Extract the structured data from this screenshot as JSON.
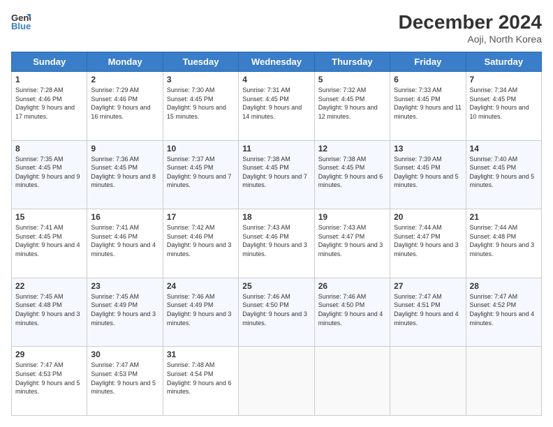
{
  "header": {
    "logo_line1": "General",
    "logo_line2": "Blue",
    "month_title": "December 2024",
    "location": "Aoji, North Korea"
  },
  "weekdays": [
    "Sunday",
    "Monday",
    "Tuesday",
    "Wednesday",
    "Thursday",
    "Friday",
    "Saturday"
  ],
  "weeks": [
    [
      {
        "day": "1",
        "sunrise": "7:28 AM",
        "sunset": "4:46 PM",
        "daylight": "9 hours and 17 minutes"
      },
      {
        "day": "2",
        "sunrise": "7:29 AM",
        "sunset": "4:46 PM",
        "daylight": "9 hours and 16 minutes"
      },
      {
        "day": "3",
        "sunrise": "7:30 AM",
        "sunset": "4:45 PM",
        "daylight": "9 hours and 15 minutes"
      },
      {
        "day": "4",
        "sunrise": "7:31 AM",
        "sunset": "4:45 PM",
        "daylight": "9 hours and 14 minutes"
      },
      {
        "day": "5",
        "sunrise": "7:32 AM",
        "sunset": "4:45 PM",
        "daylight": "9 hours and 12 minutes"
      },
      {
        "day": "6",
        "sunrise": "7:33 AM",
        "sunset": "4:45 PM",
        "daylight": "9 hours and 11 minutes"
      },
      {
        "day": "7",
        "sunrise": "7:34 AM",
        "sunset": "4:45 PM",
        "daylight": "9 hours and 10 minutes"
      }
    ],
    [
      {
        "day": "8",
        "sunrise": "7:35 AM",
        "sunset": "4:45 PM",
        "daylight": "9 hours and 9 minutes"
      },
      {
        "day": "9",
        "sunrise": "7:36 AM",
        "sunset": "4:45 PM",
        "daylight": "9 hours and 8 minutes"
      },
      {
        "day": "10",
        "sunrise": "7:37 AM",
        "sunset": "4:45 PM",
        "daylight": "9 hours and 7 minutes"
      },
      {
        "day": "11",
        "sunrise": "7:38 AM",
        "sunset": "4:45 PM",
        "daylight": "9 hours and 7 minutes"
      },
      {
        "day": "12",
        "sunrise": "7:38 AM",
        "sunset": "4:45 PM",
        "daylight": "9 hours and 6 minutes"
      },
      {
        "day": "13",
        "sunrise": "7:39 AM",
        "sunset": "4:45 PM",
        "daylight": "9 hours and 5 minutes"
      },
      {
        "day": "14",
        "sunrise": "7:40 AM",
        "sunset": "4:45 PM",
        "daylight": "9 hours and 5 minutes"
      }
    ],
    [
      {
        "day": "15",
        "sunrise": "7:41 AM",
        "sunset": "4:45 PM",
        "daylight": "9 hours and 4 minutes"
      },
      {
        "day": "16",
        "sunrise": "7:41 AM",
        "sunset": "4:46 PM",
        "daylight": "9 hours and 4 minutes"
      },
      {
        "day": "17",
        "sunrise": "7:42 AM",
        "sunset": "4:46 PM",
        "daylight": "9 hours and 3 minutes"
      },
      {
        "day": "18",
        "sunrise": "7:43 AM",
        "sunset": "4:46 PM",
        "daylight": "9 hours and 3 minutes"
      },
      {
        "day": "19",
        "sunrise": "7:43 AM",
        "sunset": "4:47 PM",
        "daylight": "9 hours and 3 minutes"
      },
      {
        "day": "20",
        "sunrise": "7:44 AM",
        "sunset": "4:47 PM",
        "daylight": "9 hours and 3 minutes"
      },
      {
        "day": "21",
        "sunrise": "7:44 AM",
        "sunset": "4:48 PM",
        "daylight": "9 hours and 3 minutes"
      }
    ],
    [
      {
        "day": "22",
        "sunrise": "7:45 AM",
        "sunset": "4:48 PM",
        "daylight": "9 hours and 3 minutes"
      },
      {
        "day": "23",
        "sunrise": "7:45 AM",
        "sunset": "4:49 PM",
        "daylight": "9 hours and 3 minutes"
      },
      {
        "day": "24",
        "sunrise": "7:46 AM",
        "sunset": "4:49 PM",
        "daylight": "9 hours and 3 minutes"
      },
      {
        "day": "25",
        "sunrise": "7:46 AM",
        "sunset": "4:50 PM",
        "daylight": "9 hours and 3 minutes"
      },
      {
        "day": "26",
        "sunrise": "7:46 AM",
        "sunset": "4:50 PM",
        "daylight": "9 hours and 4 minutes"
      },
      {
        "day": "27",
        "sunrise": "7:47 AM",
        "sunset": "4:51 PM",
        "daylight": "9 hours and 4 minutes"
      },
      {
        "day": "28",
        "sunrise": "7:47 AM",
        "sunset": "4:52 PM",
        "daylight": "9 hours and 4 minutes"
      }
    ],
    [
      {
        "day": "29",
        "sunrise": "7:47 AM",
        "sunset": "4:53 PM",
        "daylight": "9 hours and 5 minutes"
      },
      {
        "day": "30",
        "sunrise": "7:47 AM",
        "sunset": "4:53 PM",
        "daylight": "9 hours and 5 minutes"
      },
      {
        "day": "31",
        "sunrise": "7:48 AM",
        "sunset": "4:54 PM",
        "daylight": "9 hours and 6 minutes"
      },
      null,
      null,
      null,
      null
    ]
  ]
}
